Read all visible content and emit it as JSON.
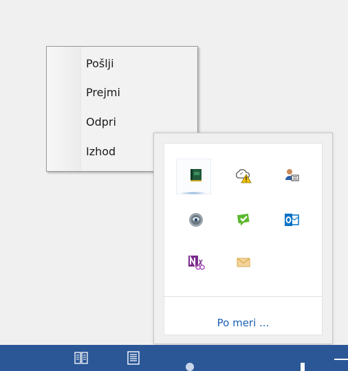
{
  "context_menu": {
    "items": [
      {
        "label": "Pošlji"
      },
      {
        "label": "Prejmi"
      },
      {
        "label": "Odpri"
      },
      {
        "label": "Izhod"
      }
    ]
  },
  "tray": {
    "customize_label": "Po meri ...",
    "icons": [
      "green-book-icon",
      "cloud-warning-icon",
      "user-card-icon",
      "webcam-icon",
      "green-check-chat-icon",
      "outlook-icon",
      "onenote-clipping-icon",
      "envelope-icon"
    ]
  },
  "taskbar": {
    "icons": [
      "book-icon",
      "document-icon"
    ]
  },
  "colors": {
    "taskbar": "#2b5797",
    "link": "#1a5fb4",
    "outlook_blue": "#0072c6",
    "onenote_purple": "#7a2a8a",
    "check_green": "#5cb82e",
    "envelope_tan": "#e8c27a"
  }
}
